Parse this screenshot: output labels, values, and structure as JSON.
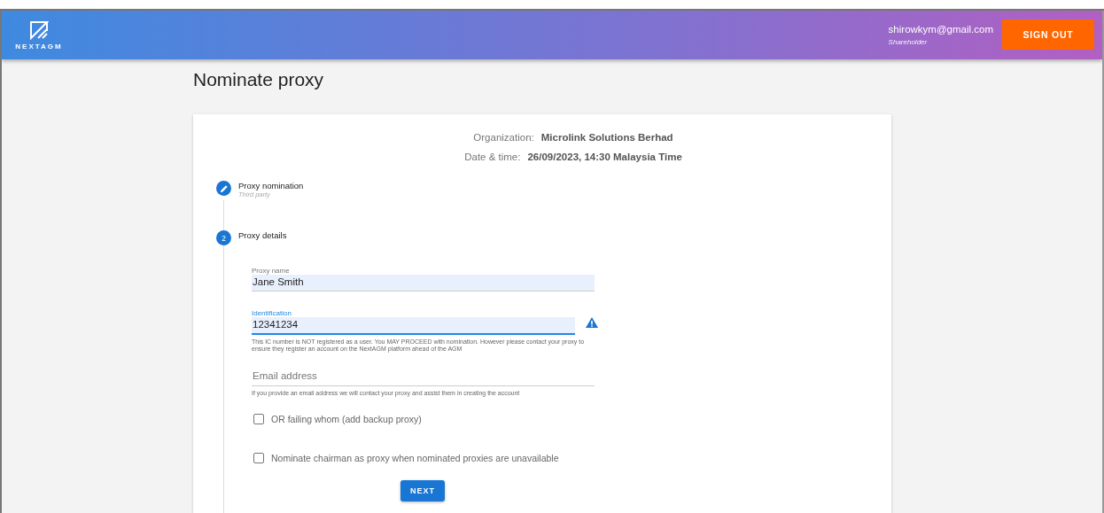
{
  "header": {
    "logo_text": "NEXTAGM",
    "user_email": "shirowkym@gmail.com",
    "user_role": "Shareholder",
    "sign_out": "SIGN OUT"
  },
  "title": "Nominate proxy",
  "meeting": [
    {
      "label": "Organization:",
      "value": "Microlink Solutions Berhad"
    },
    {
      "label": "Date & time:",
      "value": "26/09/2023, 14:30 Malaysia Time"
    }
  ],
  "steps": [
    {
      "kind": "edit",
      "title": "Proxy nomination",
      "subtitle": "Third party"
    },
    {
      "kind": "number",
      "number": "2",
      "title": "Proxy details"
    }
  ],
  "fields": [
    {
      "label": "Proxy name",
      "value": "Jane Smith",
      "focused": false,
      "warning": false
    },
    {
      "label": "Identification",
      "value": "12341234",
      "focused": true,
      "warning": true,
      "helper": "This IC number is NOT registered as a user. You MAY PROCEED with nomination. However please contact your proxy to ensure they register an account on the NextAGM platform ahead of the AGM"
    },
    {
      "placeholder": "Email address",
      "focused": false,
      "warning": false,
      "helper": "If you provide an email address we will contact your proxy and assist them in creating the account"
    }
  ],
  "checkboxes": [
    {
      "label": "OR failing whom (add backup proxy)",
      "checked": false
    },
    {
      "label": "Nominate chairman as proxy when nominated proxies are unavailable",
      "checked": false
    }
  ],
  "next_button": "NEXT"
}
